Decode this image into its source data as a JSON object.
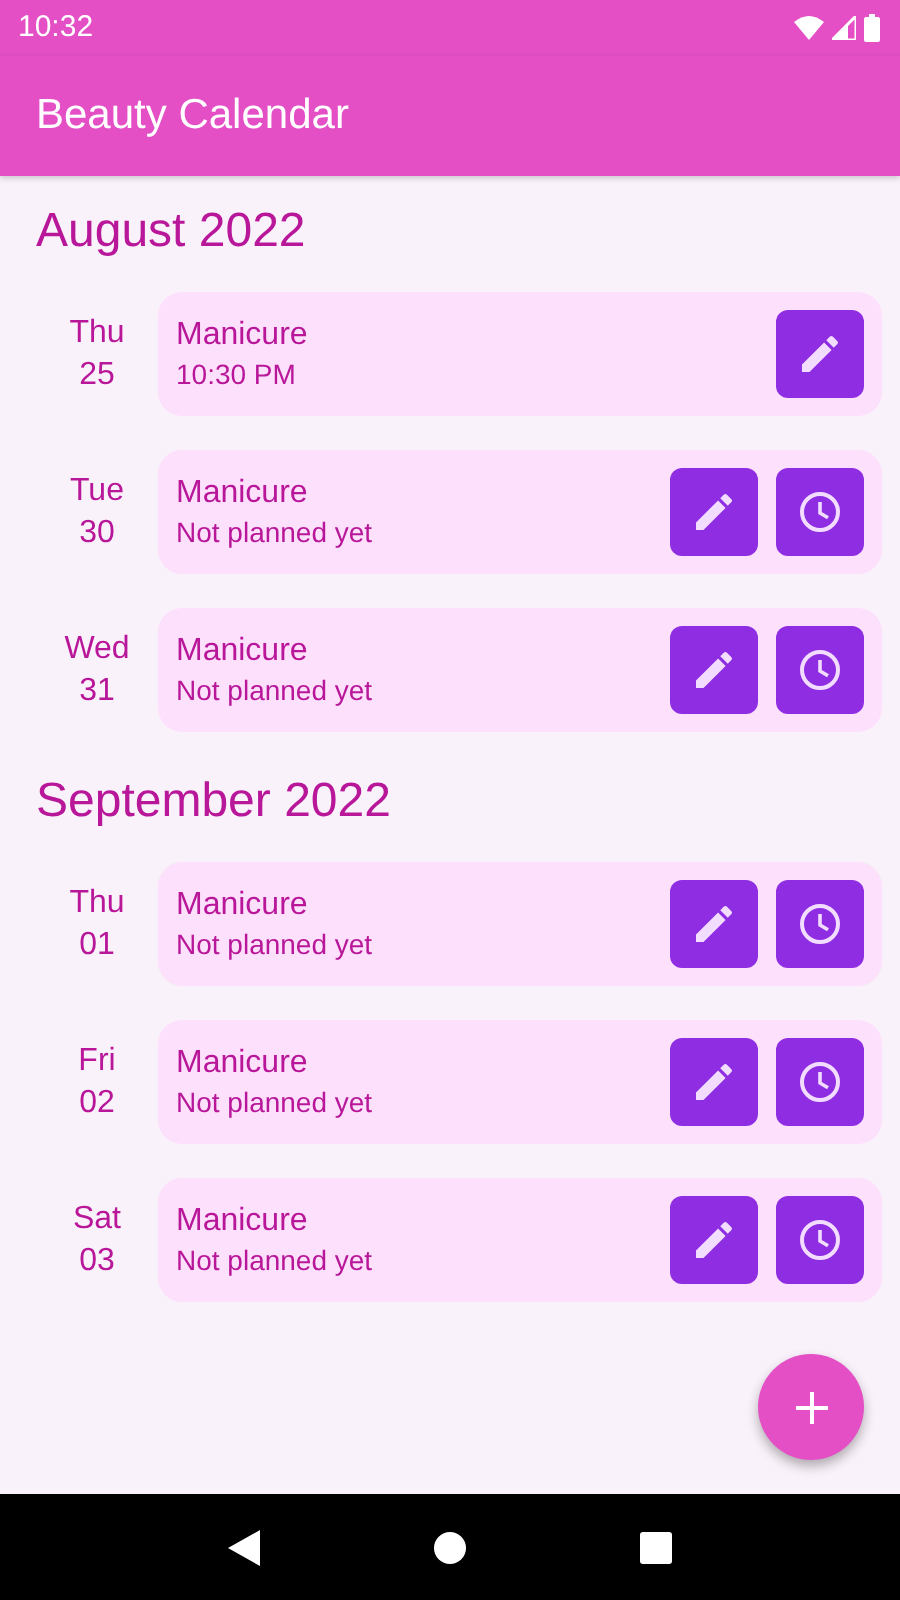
{
  "status_bar": {
    "time": "10:32"
  },
  "app_bar": {
    "title": "Beauty Calendar"
  },
  "months": [
    {
      "title": "August 2022",
      "days": [
        {
          "weekday": "Thu",
          "day": "25",
          "title": "Manicure",
          "subtitle": "10:30 PM",
          "actions": [
            {
              "kind": "edit"
            }
          ]
        },
        {
          "weekday": "Tue",
          "day": "30",
          "title": "Manicure",
          "subtitle": "Not planned yet",
          "actions": [
            {
              "kind": "edit"
            },
            {
              "kind": "schedule"
            }
          ]
        },
        {
          "weekday": "Wed",
          "day": "31",
          "title": "Manicure",
          "subtitle": "Not planned yet",
          "actions": [
            {
              "kind": "edit"
            },
            {
              "kind": "schedule"
            }
          ]
        }
      ]
    },
    {
      "title": "September 2022",
      "days": [
        {
          "weekday": "Thu",
          "day": "01",
          "title": "Manicure",
          "subtitle": "Not planned yet",
          "actions": [
            {
              "kind": "edit"
            },
            {
              "kind": "schedule"
            }
          ]
        },
        {
          "weekday": "Fri",
          "day": "02",
          "title": "Manicure",
          "subtitle": "Not planned yet",
          "actions": [
            {
              "kind": "edit"
            },
            {
              "kind": "schedule"
            }
          ]
        },
        {
          "weekday": "Sat",
          "day": "03",
          "title": "Manicure",
          "subtitle": "Not planned yet",
          "actions": [
            {
              "kind": "edit"
            },
            {
              "kind": "schedule"
            }
          ]
        }
      ]
    }
  ]
}
